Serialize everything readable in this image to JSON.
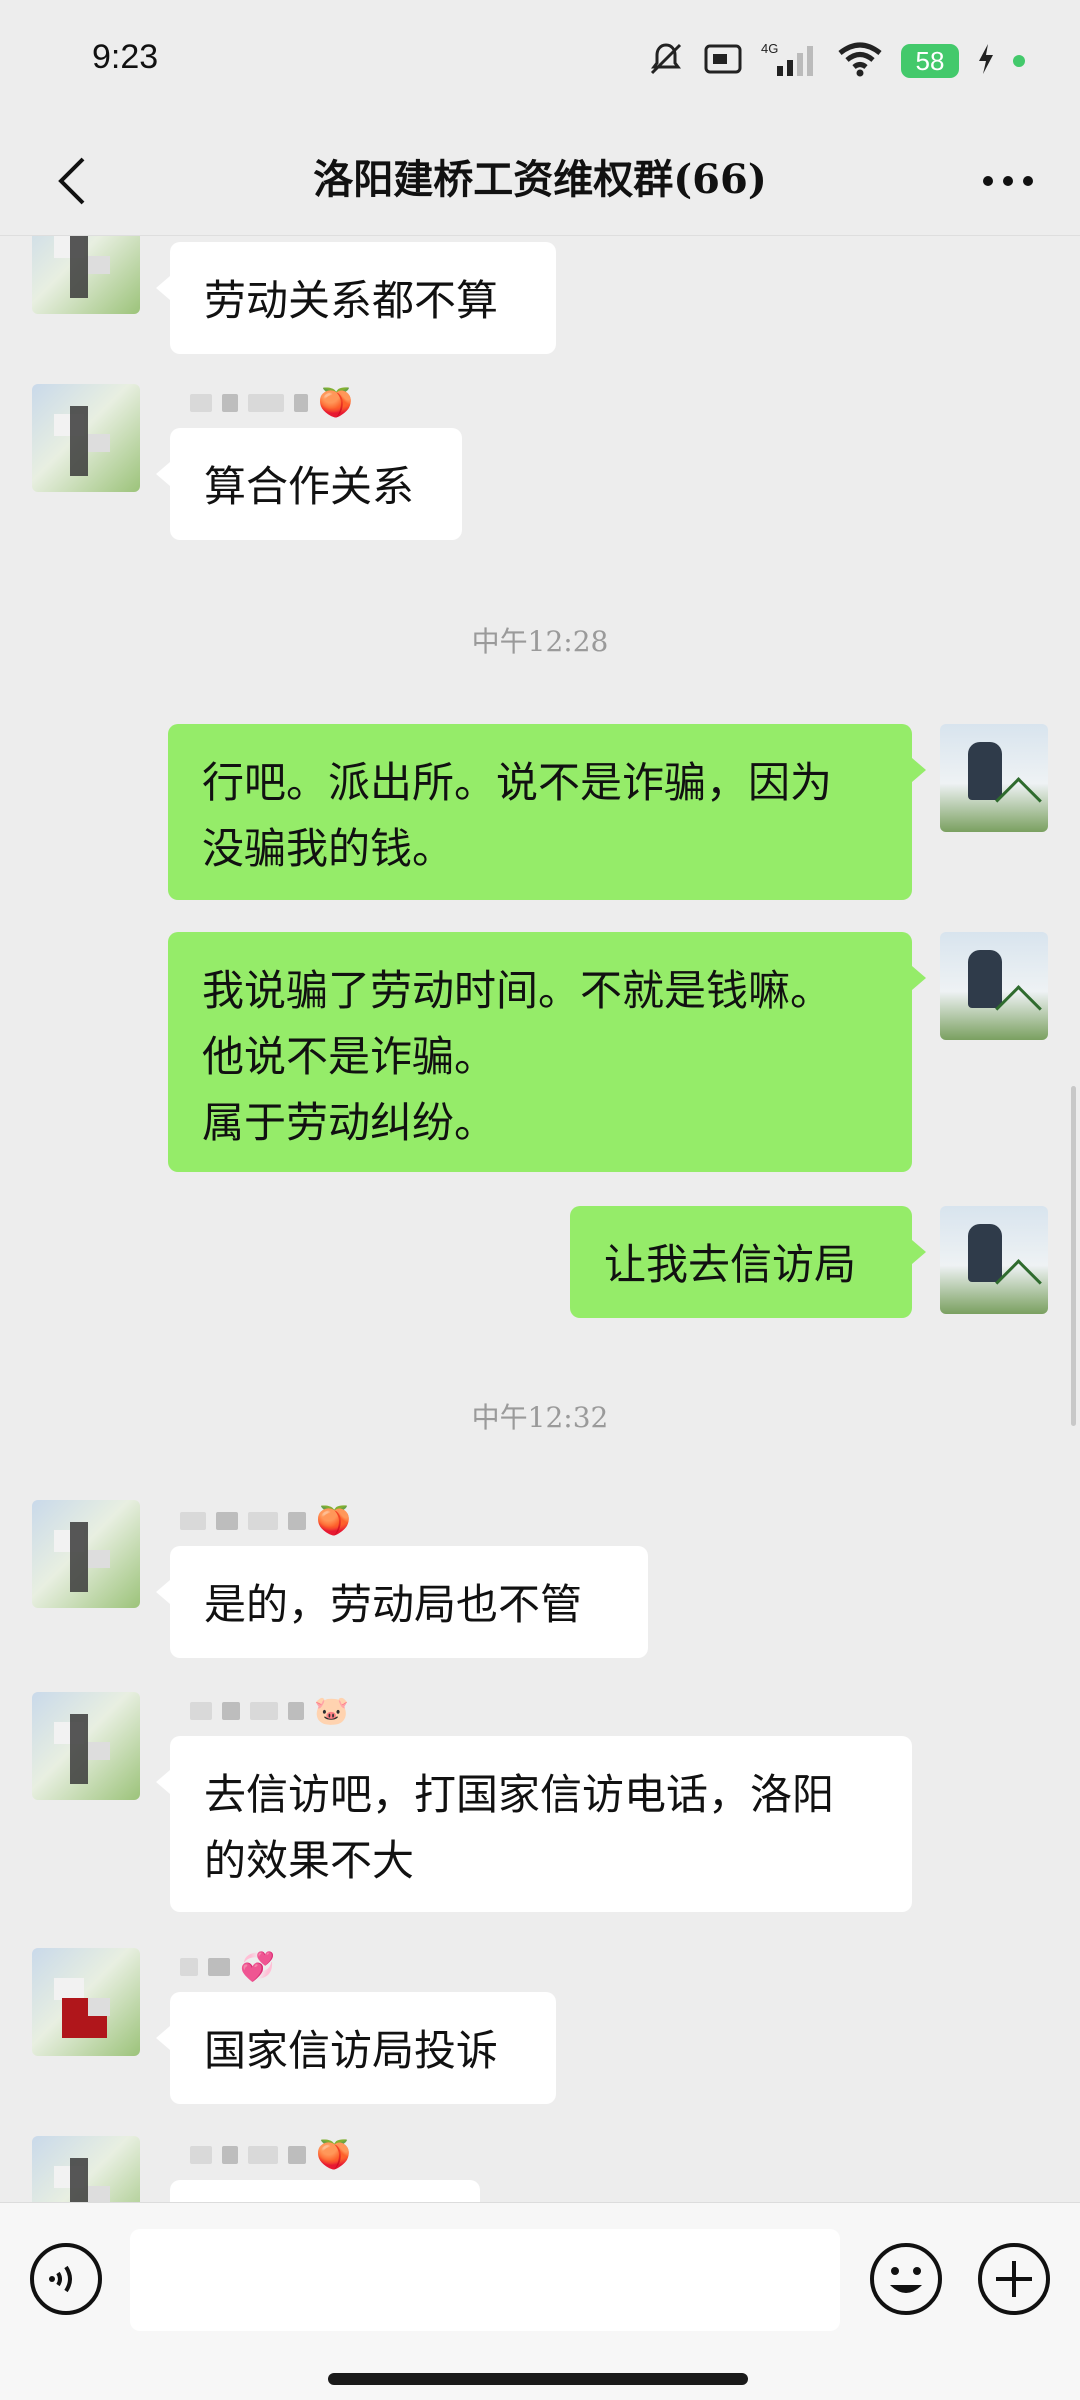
{
  "status_bar": {
    "time": "9:23",
    "network": "4G",
    "battery": "58"
  },
  "header": {
    "title": "洛阳建桥工资维权群(66)"
  },
  "messages": [
    {
      "text": "劳动关系都不算"
    },
    {
      "text": "算合作关系"
    },
    {
      "text": "行吧。派出所。说不是诈骗，因为\n没骗我的钱。"
    },
    {
      "text": "我说骗了劳动时间。不就是钱嘛。\n他说不是诈骗。\n属于劳动纠纷。"
    },
    {
      "text": "让我去信访局"
    },
    {
      "text": "是的，劳动局也不管"
    },
    {
      "text": "去信访吧，打国家信访电话，洛阳\n的效果不大"
    },
    {
      "text": "国家信访局投诉"
    }
  ],
  "timestamps": {
    "t1": "中午12:28",
    "t2": "中午12:32"
  },
  "sender_icons": {
    "peach": "🍑",
    "pig": "🐷",
    "hearts": "💞"
  },
  "input": {
    "placeholder": ""
  },
  "colors": {
    "background": "#ededed",
    "incoming_bubble": "#ffffff",
    "outgoing_bubble": "#95ec69",
    "battery": "#43c96b"
  }
}
